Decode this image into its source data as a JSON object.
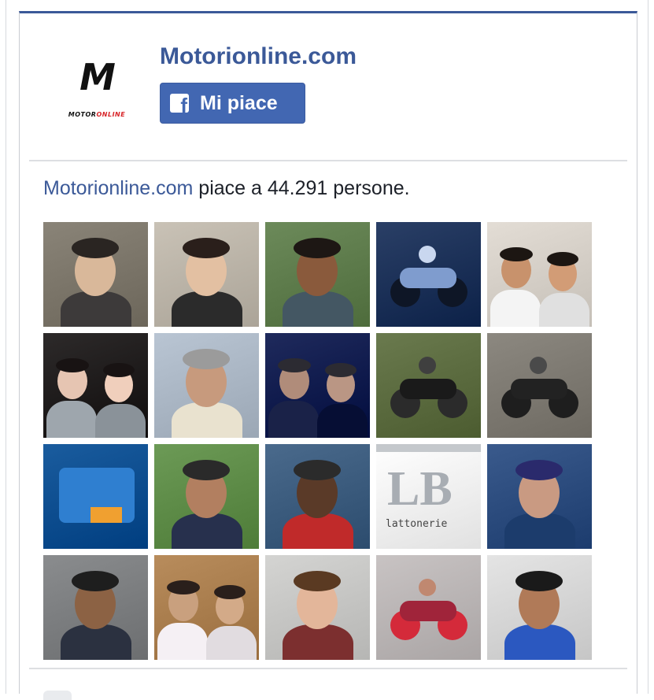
{
  "page": {
    "name": "Motorionline.com",
    "logo_letter": "M",
    "logo_word_left": "MOTOR",
    "logo_word_right": "ONLINE"
  },
  "like_button": {
    "label": "Mi piace",
    "icon": "facebook-f-icon",
    "color": "#4267b2"
  },
  "summary": {
    "link_text": "Motorionline.com",
    "text": " piace a 44.291 persone."
  },
  "friends_grid": {
    "rows": 4,
    "columns": 5,
    "tiles": [
      {
        "kind": "person",
        "bg": "#8a8478",
        "skin": "#d9b89a",
        "shirt": "#3d3a3a",
        "hair": "#2a2522"
      },
      {
        "kind": "person",
        "bg": "#c9c2b6",
        "skin": "#e3c0a2",
        "shirt": "#2b2b2b",
        "hair": "#2a1f1b"
      },
      {
        "kind": "person",
        "bg": "#6c8a5a",
        "skin": "#8a5a3c",
        "shirt": "#445763",
        "hair": "#1d1714"
      },
      {
        "kind": "moto",
        "bg": "#2a3f66",
        "skin": "#c9d7ef",
        "shirt": "#0e1626",
        "hair": "#7f9cce"
      },
      {
        "kind": "couple",
        "bg": "#e3ddd5",
        "skin": "#c8926c",
        "shirt": "#f4f4f4",
        "hair": "#1c1612"
      },
      {
        "kind": "couple",
        "bg": "#2d2a2a",
        "skin": "#e6c5b2",
        "shirt": "#9ea6ad",
        "hair": "#181313"
      },
      {
        "kind": "person",
        "bg": "#b9c5d3",
        "skin": "#c79a7d",
        "shirt": "#e9e2cf",
        "hair": "#9b9b9b"
      },
      {
        "kind": "couple",
        "bg": "#1f2a5c",
        "skin": "#b08c7a",
        "shirt": "#1a2248",
        "hair": "#2c2b32"
      },
      {
        "kind": "moto",
        "bg": "#6a7a4e",
        "skin": "#3f3f3f",
        "shirt": "#2b2b2b",
        "hair": "#1a1a1a"
      },
      {
        "kind": "moto",
        "bg": "#8c8880",
        "skin": "#4a4a4a",
        "shirt": "#1e1e1e",
        "hair": "#222222"
      },
      {
        "kind": "object",
        "bg": "#1a5c9e",
        "skin": "#2f7fd0",
        "shirt": "#f0a030",
        "hair": "#0e3c6c"
      },
      {
        "kind": "person",
        "bg": "#6c9a56",
        "skin": "#b27f60",
        "shirt": "#27304d",
        "hair": "#2a2a2a"
      },
      {
        "kind": "person",
        "bg": "#4a6a8c",
        "skin": "#5a3a28",
        "shirt": "#c02a2a",
        "hair": "#2b2b2b"
      },
      {
        "kind": "logo",
        "bg": "#ffffff",
        "skin": "#a8adb3",
        "shirt": "#555555",
        "hair": "#c4c8cc",
        "logo_big": "LB",
        "logo_small": "lattonerie"
      },
      {
        "kind": "person",
        "bg": "#3a5a8c",
        "skin": "#c99a82",
        "shirt": "#1c3c6c",
        "hair": "#2a2a6c"
      },
      {
        "kind": "person",
        "bg": "#8a8c8e",
        "skin": "#8c6244",
        "shirt": "#2b3140",
        "hair": "#1e1e1e"
      },
      {
        "kind": "couple",
        "bg": "#b88c5c",
        "skin": "#c9a07e",
        "shirt": "#f5f0f4",
        "hair": "#2a1f1b"
      },
      {
        "kind": "person",
        "bg": "#d4d4d2",
        "skin": "#e3b69a",
        "shirt": "#7c2f2f",
        "hair": "#5a3a22"
      },
      {
        "kind": "moto",
        "bg": "#c8c3c3",
        "skin": "#c08870",
        "shirt": "#d42a3a",
        "hair": "#a0243a"
      },
      {
        "kind": "person",
        "bg": "#e4e4e4",
        "skin": "#b07a58",
        "shirt": "#2b58c0",
        "hair": "#1a1a1a"
      }
    ]
  }
}
